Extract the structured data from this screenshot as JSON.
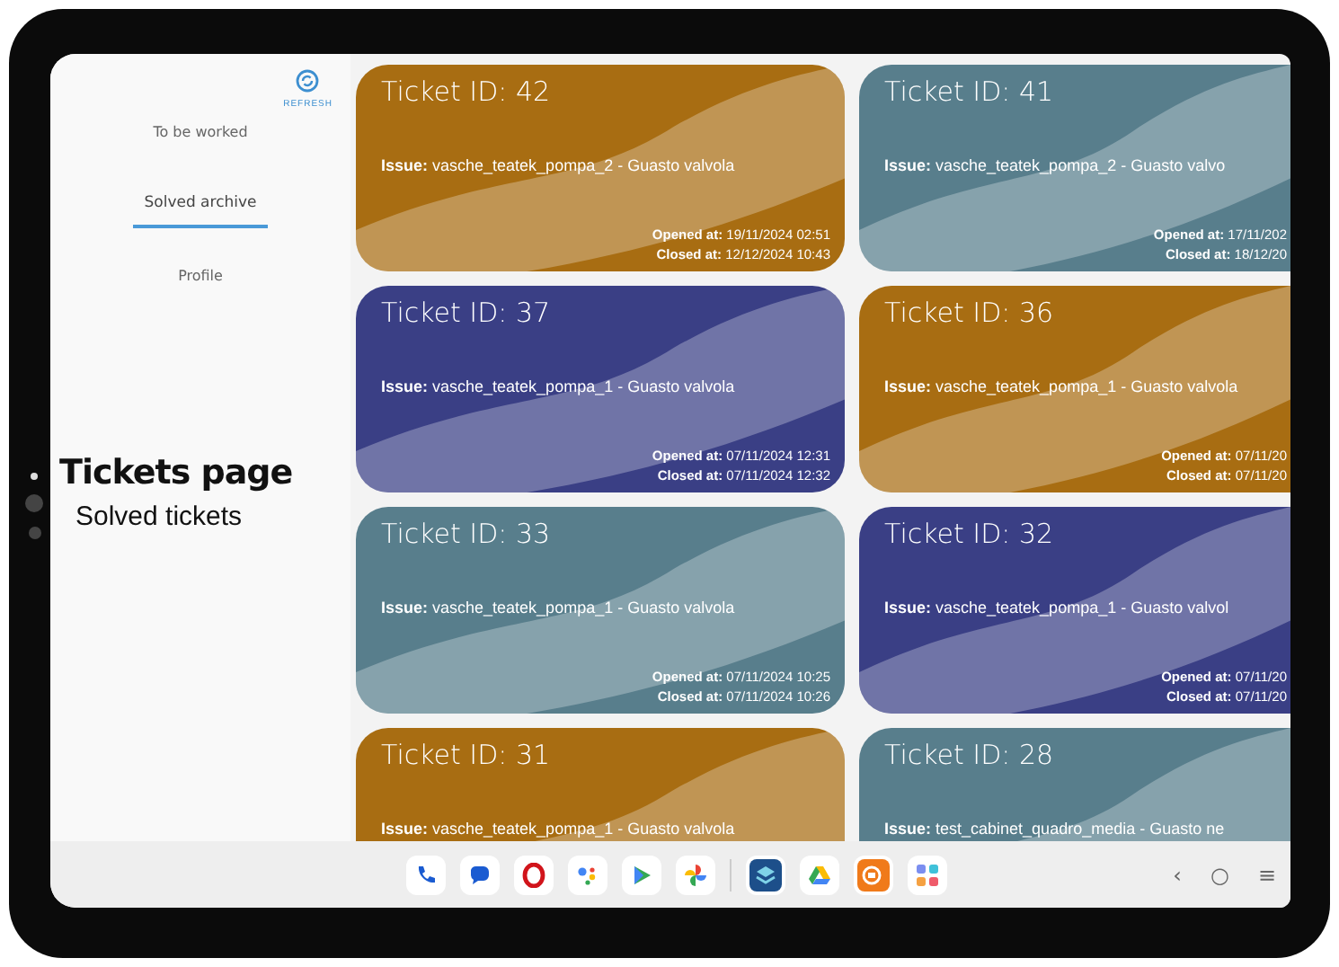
{
  "sidebar": {
    "refresh_label": "REFRESH",
    "items": [
      {
        "label": "To be worked",
        "selected": false
      },
      {
        "label": "Solved archive",
        "selected": true
      },
      {
        "label": "Profile",
        "selected": false
      }
    ]
  },
  "caption": {
    "title": "Tickets page",
    "subtitle": "Solved tickets"
  },
  "tickets": [
    {
      "title": "Ticket ID: 42",
      "issue": "**Issue:** vasche_teatek_pompa_2 - Guasto valvola",
      "opened": "**Opened at:** 19/11/2024 02:51",
      "closed": "**Closed at:** 12/12/2024 10:43",
      "color": "#a86d12"
    },
    {
      "title": "Ticket ID: 41",
      "issue": "**Issue:** vasche_teatek_pompa_2 - Guasto valvo",
      "opened": "**Opened at:** 17/11/202",
      "closed": "**Closed at:** 18/12/20",
      "color": "#587e8c"
    },
    {
      "title": "Ticket ID: 37",
      "issue": "**Issue:** vasche_teatek_pompa_1 - Guasto valvola",
      "opened": "**Opened at:** 07/11/2024 12:31",
      "closed": "**Closed at:** 07/11/2024 12:32",
      "color": "#3a3f85"
    },
    {
      "title": "Ticket ID: 36",
      "issue": "**Issue:** vasche_teatek_pompa_1 - Guasto valvola",
      "opened": "**Opened at:** 07/11/20",
      "closed": "**Closed at:** 07/11/20",
      "color": "#a86d12"
    },
    {
      "title": "Ticket ID: 33",
      "issue": "**Issue:** vasche_teatek_pompa_1 - Guasto valvola",
      "opened": "**Opened at:** 07/11/2024 10:25",
      "closed": "**Closed at:** 07/11/2024 10:26",
      "color": "#587e8c"
    },
    {
      "title": "Ticket ID: 32",
      "issue": "**Issue:** vasche_teatek_pompa_1 - Guasto valvol",
      "opened": "**Opened at:** 07/11/20",
      "closed": "**Closed at:** 07/11/20",
      "color": "#3a3f85"
    },
    {
      "title": "Ticket ID: 31",
      "issue": "**Issue:** vasche_teatek_pompa_1 - Guasto valvola",
      "color": "#a86d12"
    },
    {
      "title": "Ticket ID: 28",
      "issue": "**Issue:** test_cabinet_quadro_media - Guasto ne",
      "color": "#587e8c"
    }
  ],
  "nav_buttons": [
    "‹",
    "○",
    "≡"
  ]
}
